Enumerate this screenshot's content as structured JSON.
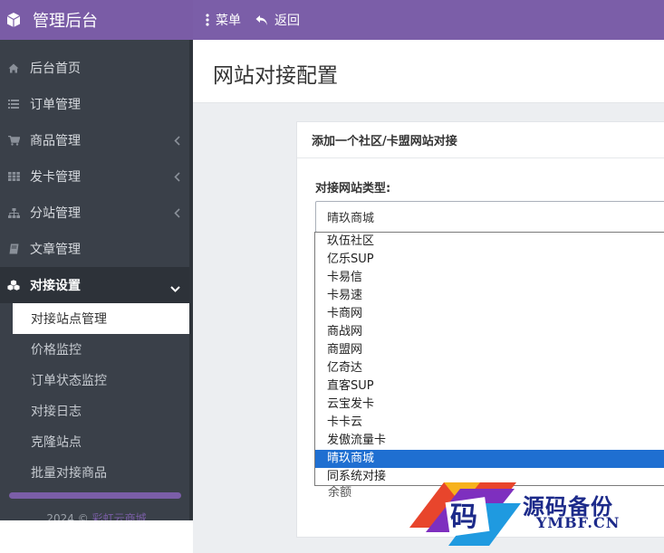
{
  "brand": {
    "title": "管理后台",
    "icon": "cube-icon"
  },
  "topnav": {
    "menu_label": "菜单",
    "back_label": "返回"
  },
  "sidebar": {
    "items": [
      {
        "label": "后台首页",
        "icon": "home-icon",
        "has_chevron": false
      },
      {
        "label": "订单管理",
        "icon": "list-icon",
        "has_chevron": false
      },
      {
        "label": "商品管理",
        "icon": "cart-icon",
        "has_chevron": true
      },
      {
        "label": "发卡管理",
        "icon": "grid-icon",
        "has_chevron": true
      },
      {
        "label": "分站管理",
        "icon": "sitemap-icon",
        "has_chevron": true
      },
      {
        "label": "文章管理",
        "icon": "book-icon",
        "has_chevron": false
      },
      {
        "label": "对接设置",
        "icon": "cubes-icon",
        "has_chevron": true,
        "open": true
      }
    ],
    "sub_items": [
      {
        "label": "对接站点管理",
        "active": true
      },
      {
        "label": "价格监控"
      },
      {
        "label": "订单状态监控"
      },
      {
        "label": "对接日志"
      },
      {
        "label": "克隆站点"
      },
      {
        "label": "批量对接商品"
      }
    ],
    "copyright_prefix": "2024 ©",
    "copyright_link": "彩虹云商城"
  },
  "page": {
    "title": "网站对接配置",
    "panel_title": "添加一个社区/卡盟网站对接",
    "field_label": "对接网站类型:",
    "selected_value": "晴玖商城",
    "under_field_text": "余额"
  },
  "dropdown": {
    "options": [
      "玖伍社区",
      "亿乐SUP",
      "卡易信",
      "卡易速",
      "卡商网",
      "商战网",
      "商盟网",
      "亿奇达",
      "直客SUP",
      "云宝发卡",
      "卡卡云",
      "发傲流量卡",
      "晴玖商城",
      "同系统对接"
    ],
    "selected_index": 12
  },
  "watermark": {
    "logo_char": "码",
    "title": "源码备份",
    "subtitle": "YMBF.CN"
  },
  "colors": {
    "accent": "#7b5ea8",
    "sidebar_bg": "#3a4049",
    "selection_blue": "#1f6fd1"
  }
}
